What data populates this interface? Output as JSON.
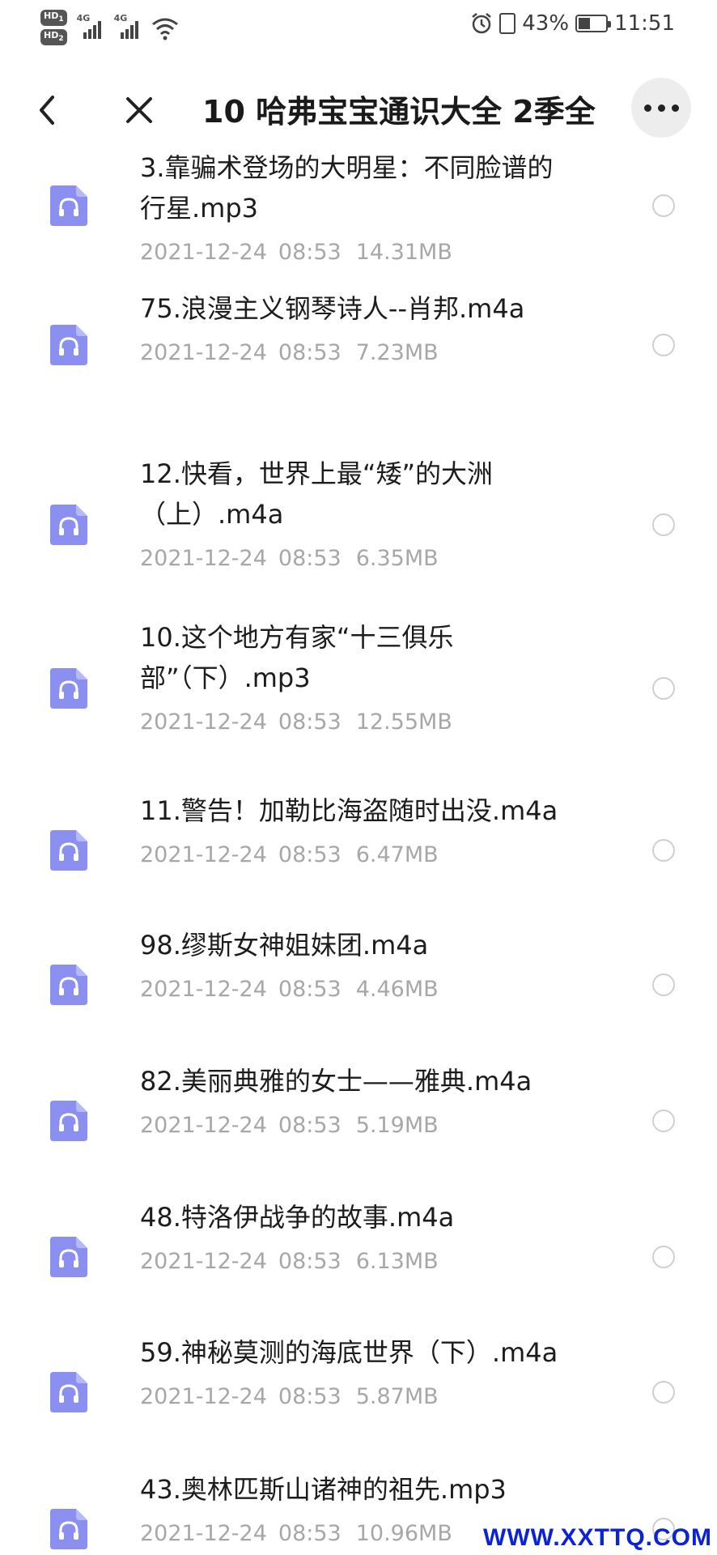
{
  "status_bar": {
    "hd1": "HD",
    "hd1_sub": "1",
    "hd2": "HD",
    "hd2_sub": "2",
    "net1": "4G",
    "net2": "4G",
    "battery": "43%",
    "time": "11:51"
  },
  "header": {
    "title": "10 哈弗宝宝通识大全 2季全"
  },
  "files": [
    {
      "name_lines": [
        "3.靠骗术登场的大明星：不同脸谱的",
        "行星.mp3"
      ],
      "date": "2021-12-24",
      "time": "08:53",
      "size": "14.31MB"
    },
    {
      "name_lines": [
        "75.浪漫主义钢琴诗人--肖邦.m4a"
      ],
      "date": "2021-12-24",
      "time": "08:53",
      "size": "7.23MB"
    },
    {
      "name_lines": [
        "12.快看，世界上最“矮”的大洲",
        "（上）.m4a"
      ],
      "date": "2021-12-24",
      "time": "08:53",
      "size": "6.35MB"
    },
    {
      "name_lines": [
        "10.这个地方有家“十三俱乐",
        "部”（下）.mp3"
      ],
      "date": "2021-12-24",
      "time": "08:53",
      "size": "12.55MB"
    },
    {
      "name_lines": [
        "11.警告！加勒比海盗随时出没.m4a"
      ],
      "date": "2021-12-24",
      "time": "08:53",
      "size": "6.47MB"
    },
    {
      "name_lines": [
        "98.缪斯女神姐妹团.m4a"
      ],
      "date": "2021-12-24",
      "time": "08:53",
      "size": "4.46MB"
    },
    {
      "name_lines": [
        "82.美丽典雅的女士——雅典.m4a"
      ],
      "date": "2021-12-24",
      "time": "08:53",
      "size": "5.19MB"
    },
    {
      "name_lines": [
        "48.特洛伊战争的故事.m4a"
      ],
      "date": "2021-12-24",
      "time": "08:53",
      "size": "6.13MB"
    },
    {
      "name_lines": [
        "59.神秘莫测的海底世界（下）.m4a"
      ],
      "date": "2021-12-24",
      "time": "08:53",
      "size": "5.87MB"
    },
    {
      "name_lines": [
        "43.奥林匹斯山诸神的祖先.mp3"
      ],
      "date": "2021-12-24",
      "time": "08:53",
      "size": "10.96MB"
    }
  ],
  "icons": {
    "file": "audio-file-icon",
    "back": "chevron-left-icon",
    "close": "close-icon",
    "more": "more-dots-icon"
  },
  "colors": {
    "file_icon": "#8b8ff0",
    "meta_text": "#a7a7a7",
    "more_button_bg": "#ededed",
    "watermark": "#0a22d8"
  },
  "watermark": "WWW.XXTTQ.COM"
}
